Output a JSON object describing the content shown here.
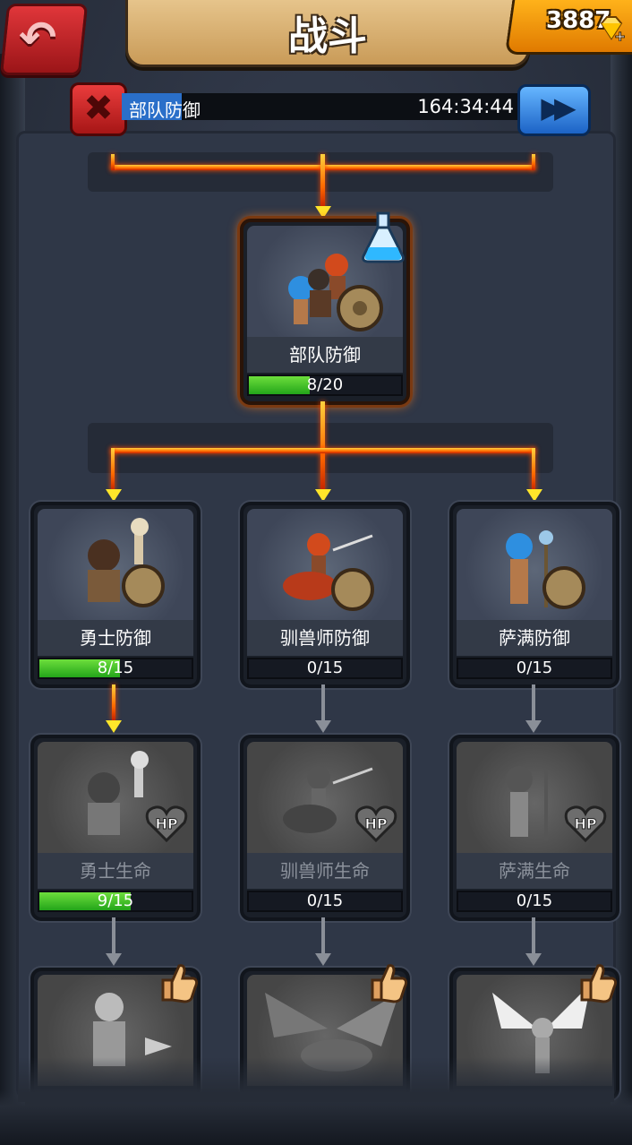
{
  "header": {
    "title": "战斗",
    "gems": "3887"
  },
  "research": {
    "name": "部队防御",
    "time_left": "164:34:44",
    "progress": 0.15
  },
  "colors": {
    "lava": "#ff6a00",
    "progress_green": "#23a51a",
    "research_blue": "#2a6fc9"
  },
  "tree": {
    "root": {
      "label": "部队防御",
      "progress_text": "8/20",
      "progress": 0.4,
      "badge": "potion-icon"
    },
    "defense": [
      {
        "label": "勇士防御",
        "progress_text": "8/15",
        "progress": 0.53
      },
      {
        "label": "驯兽师防御",
        "progress_text": "0/15",
        "progress": 0
      },
      {
        "label": "萨满防御",
        "progress_text": "0/15",
        "progress": 0
      }
    ],
    "life": [
      {
        "label": "勇士生命",
        "progress_text": "9/15",
        "progress": 0.6,
        "badge": "HP"
      },
      {
        "label": "驯兽师生命",
        "progress_text": "0/15",
        "progress": 0,
        "badge": "HP"
      },
      {
        "label": "萨满生命",
        "progress_text": "0/15",
        "progress": 0,
        "badge": "HP"
      }
    ],
    "units": [
      {
        "icon": "minotaur-knight-icon",
        "badge": "thumbs-up-icon"
      },
      {
        "icon": "dragon-rider-icon",
        "badge": "thumbs-up-icon"
      },
      {
        "icon": "winged-angel-icon",
        "badge": "thumbs-up-icon"
      }
    ]
  }
}
